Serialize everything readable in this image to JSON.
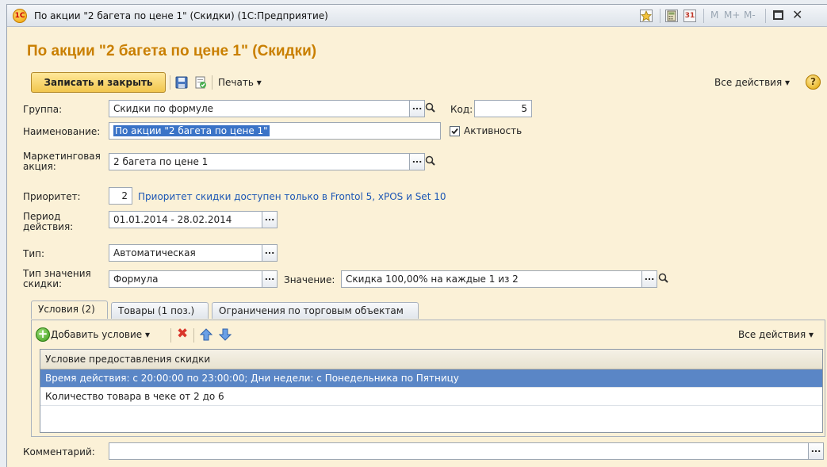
{
  "window": {
    "title": "По акции \"2 багета по цене 1\" (Скидки)  (1С:Предприятие)",
    "memory_buttons": [
      "M",
      "M+",
      "M-"
    ],
    "colors": {
      "accent": "#c97f00",
      "selection": "#5a86c6",
      "link": "#1d57b5"
    }
  },
  "form": {
    "title": "По акции \"2 багета по цене 1\" (Скидки)",
    "save_close": "Записать и закрыть",
    "print": "Печать ▾",
    "all_actions": "Все действия ▾",
    "help": "?"
  },
  "fields": {
    "group_label": "Группа:",
    "group_value": "Скидки по формуле",
    "code_label": "Код:",
    "code_value": "5",
    "name_label": "Наименование:",
    "name_value": "По акции \"2 багета по цене 1\"",
    "active_label": "Активность",
    "active_checked": true,
    "marketing_label_1": "Маркетинговая",
    "marketing_label_2": "акция:",
    "marketing_value": "2 багета по цене 1",
    "priority_label": "Приоритет:",
    "priority_value": "2",
    "priority_note": "Приоритет скидки доступен только в Frontol 5, xPOS и Set 10",
    "period_label_1": "Период",
    "period_label_2": "действия:",
    "period_value": "01.01.2014 - 28.02.2014",
    "type_label": "Тип:",
    "type_value": "Автоматическая",
    "valtype_label_1": "Тип значения",
    "valtype_label_2": "скидки:",
    "valtype_value": "Формула",
    "value_label": "Значение:",
    "value_value": "Скидка 100,00% на каждые 1 из 2",
    "comment_label": "Комментарий:",
    "comment_value": ""
  },
  "tabs": [
    {
      "label": "Условия (2)",
      "active": true
    },
    {
      "label": "Товары (1 поз.)",
      "active": false
    },
    {
      "label": "Ограничения по торговым объектам",
      "active": false
    }
  ],
  "conditions": {
    "add_label": "Добавить условие ▾",
    "all_actions": "Все действия ▾",
    "column": "Условие предоставления скидки",
    "rows": [
      "Время действия: с 20:00:00 по 23:00:00; Дни недели: с Понедельника по Пятницу",
      "Количество товара в чеке от 2 до 6"
    ]
  }
}
